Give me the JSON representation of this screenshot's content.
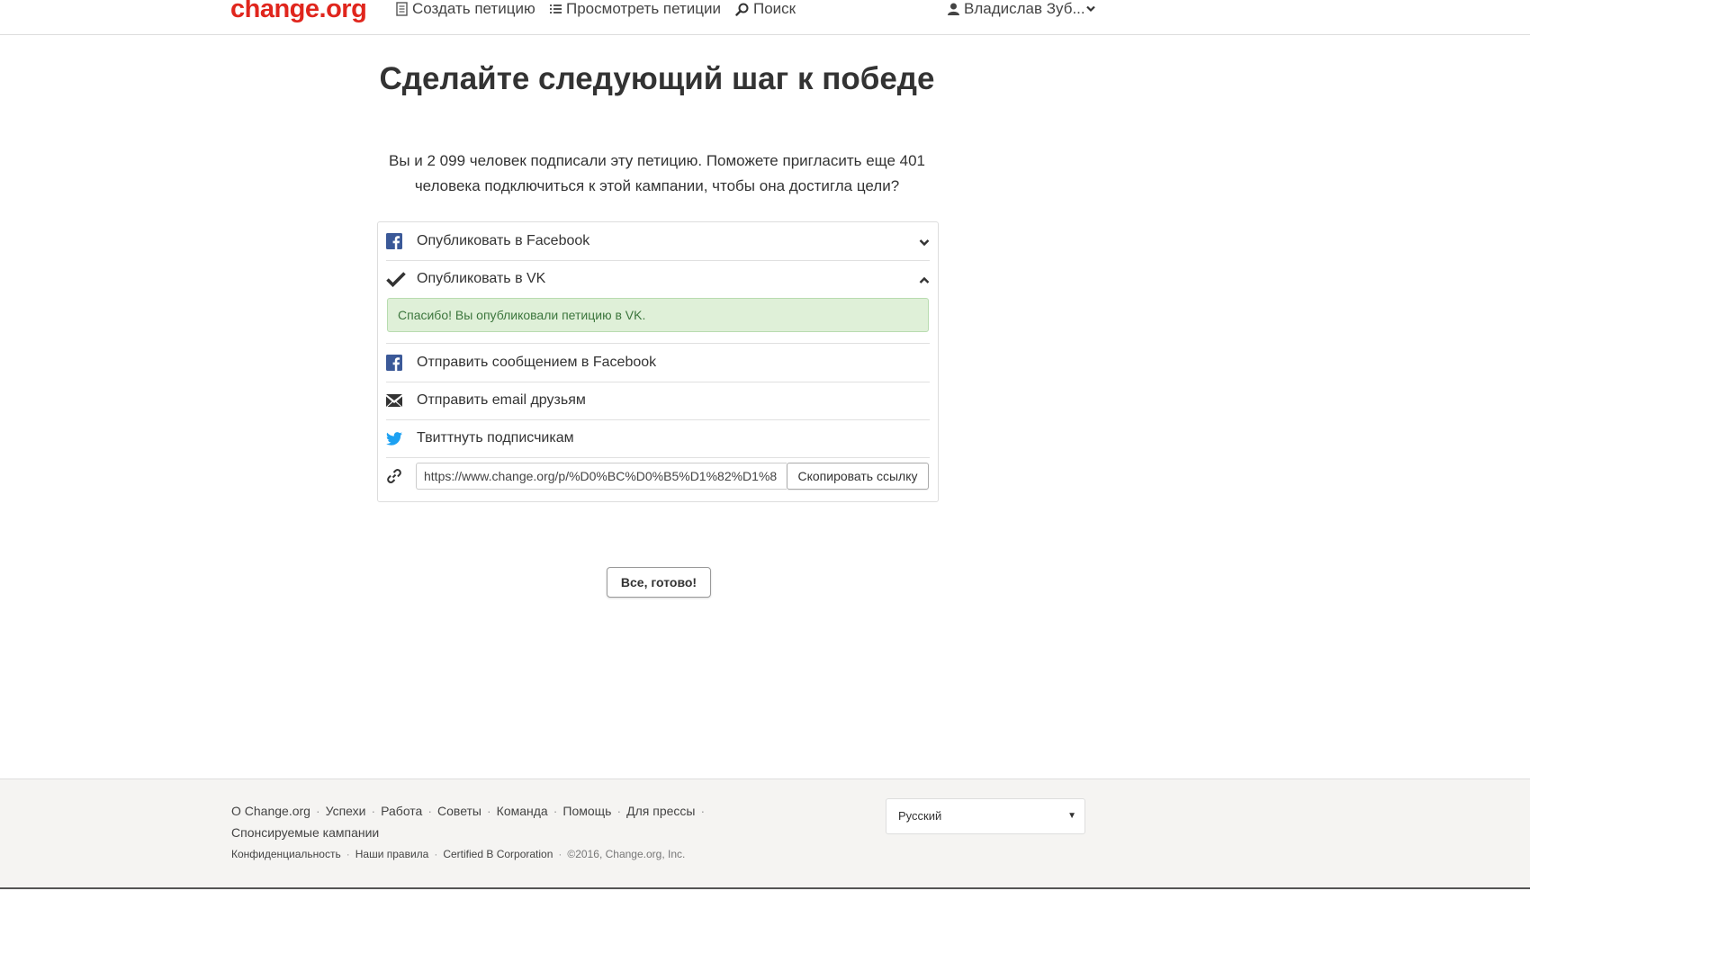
{
  "header": {
    "logo": "change.org",
    "nav": {
      "create": "Создать петицию",
      "browse": "Просмотреть петиции",
      "search": "Поиск"
    },
    "user": "Владислав Зуб..."
  },
  "main": {
    "title": "Сделайте следующий шаг к победе",
    "lead": "Вы и 2 099 человек подписали эту петицию. Поможете пригласить еще 401 человека подключиться к этой кампании, чтобы она достигла цели?",
    "share": {
      "facebook_post": "Опубликовать в Facebook",
      "vk_post": "Опубликовать в VK",
      "vk_success": "Спасибо! Вы опубликовали петицию в VK.",
      "facebook_message": "Отправить сообщением в Facebook",
      "email": "Отправить email друзьям",
      "twitter": "Твиттнуть подписчикам",
      "link_value": "https://www.change.org/p/%D0%BC%D0%B5%D1%82%D1%8",
      "copy_label": "Скопировать ссылку"
    },
    "done_label": "Все, готово!"
  },
  "footer": {
    "links": [
      "О Change.org",
      "Успехи",
      "Работа",
      "Советы",
      "Команда",
      "Помощь",
      "Для прессы",
      "Спонсируемые кампании"
    ],
    "legal": [
      "Конфиденциальность",
      "Наши правила",
      "Certified B Corporation"
    ],
    "copyright": "©2016, Change.org, Inc.",
    "language": "Русский"
  },
  "colors": {
    "brand": "#e0261d",
    "facebook": "#3b5998",
    "twitter": "#1da1f2",
    "success_bg": "#dff0d8",
    "success_text": "#3c763d"
  },
  "icons": [
    "document-icon",
    "list-icon",
    "search-icon",
    "user-icon",
    "chevron-down-icon",
    "facebook-icon",
    "checkmark-icon",
    "chevron-up-icon",
    "envelope-icon",
    "twitter-icon",
    "link-icon"
  ]
}
